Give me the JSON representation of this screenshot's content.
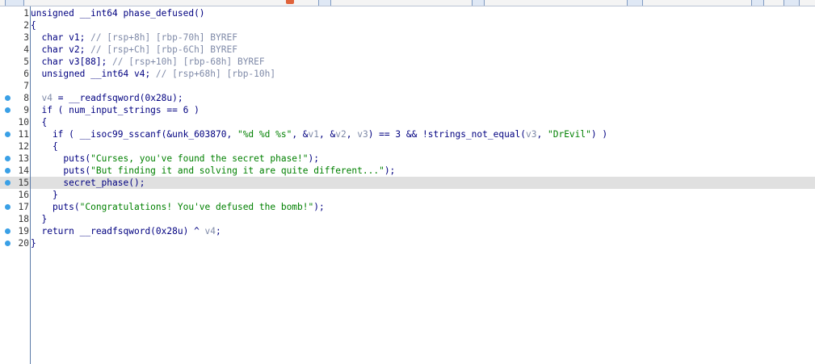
{
  "tabs": [
    {
      "label": ""
    },
    {
      "label": ""
    },
    {
      "label": ""
    },
    {
      "label": ""
    },
    {
      "label": ""
    },
    {
      "label": ""
    }
  ],
  "breakpoint_color": "#3aa0e6",
  "highlighted_line": 15,
  "lines": [
    {
      "n": "1",
      "bp": false,
      "segs": [
        {
          "t": "unsigned __int64 phase_defused()",
          "c": "fn"
        }
      ]
    },
    {
      "n": "2",
      "bp": false,
      "segs": [
        {
          "t": "{",
          "c": "fn"
        }
      ]
    },
    {
      "n": "3",
      "bp": false,
      "segs": [
        {
          "t": "  char v1; ",
          "c": "fn"
        },
        {
          "t": "// [rsp+8h] [rbp-70h] BYREF",
          "c": "cm"
        }
      ]
    },
    {
      "n": "4",
      "bp": false,
      "segs": [
        {
          "t": "  char v2; ",
          "c": "fn"
        },
        {
          "t": "// [rsp+Ch] [rbp-6Ch] BYREF",
          "c": "cm"
        }
      ]
    },
    {
      "n": "5",
      "bp": false,
      "segs": [
        {
          "t": "  char v3[88]; ",
          "c": "fn"
        },
        {
          "t": "// [rsp+10h] [rbp-68h] BYREF",
          "c": "cm"
        }
      ]
    },
    {
      "n": "6",
      "bp": false,
      "segs": [
        {
          "t": "  unsigned __int64 v4; ",
          "c": "fn"
        },
        {
          "t": "// [rsp+68h] [rbp-10h]",
          "c": "cm"
        }
      ]
    },
    {
      "n": "7",
      "bp": false,
      "segs": [
        {
          "t": "",
          "c": "fn"
        }
      ]
    },
    {
      "n": "8",
      "bp": true,
      "segs": [
        {
          "t": "  ",
          "c": "fn"
        },
        {
          "t": "v4",
          "c": "var"
        },
        {
          "t": " = __readfsqword(0x28u);",
          "c": "fn"
        }
      ]
    },
    {
      "n": "9",
      "bp": true,
      "segs": [
        {
          "t": "  if ( num_input_strings == 6 )",
          "c": "fn"
        }
      ]
    },
    {
      "n": "10",
      "bp": false,
      "segs": [
        {
          "t": "  {",
          "c": "fn"
        }
      ]
    },
    {
      "n": "11",
      "bp": true,
      "segs": [
        {
          "t": "    if ( __isoc99_sscanf(&unk_603870, ",
          "c": "fn"
        },
        {
          "t": "\"%d %d %s\"",
          "c": "str"
        },
        {
          "t": ", &",
          "c": "fn"
        },
        {
          "t": "v1",
          "c": "var"
        },
        {
          "t": ", &",
          "c": "fn"
        },
        {
          "t": "v2",
          "c": "var"
        },
        {
          "t": ", ",
          "c": "fn"
        },
        {
          "t": "v3",
          "c": "var"
        },
        {
          "t": ") == 3 && !strings_not_equal(",
          "c": "fn"
        },
        {
          "t": "v3",
          "c": "var"
        },
        {
          "t": ", ",
          "c": "fn"
        },
        {
          "t": "\"DrEvil\"",
          "c": "str"
        },
        {
          "t": ") )",
          "c": "fn"
        }
      ]
    },
    {
      "n": "12",
      "bp": false,
      "segs": [
        {
          "t": "    {",
          "c": "fn"
        }
      ]
    },
    {
      "n": "13",
      "bp": true,
      "segs": [
        {
          "t": "      puts(",
          "c": "fn"
        },
        {
          "t": "\"Curses, you've found the secret phase!\"",
          "c": "str"
        },
        {
          "t": ");",
          "c": "fn"
        }
      ]
    },
    {
      "n": "14",
      "bp": true,
      "segs": [
        {
          "t": "      puts(",
          "c": "fn"
        },
        {
          "t": "\"But finding it and solving it are quite different...\"",
          "c": "str"
        },
        {
          "t": ");",
          "c": "fn"
        }
      ]
    },
    {
      "n": "15",
      "bp": true,
      "segs": [
        {
          "t": "      secret_phase();",
          "c": "fn"
        }
      ]
    },
    {
      "n": "16",
      "bp": false,
      "segs": [
        {
          "t": "    }",
          "c": "fn"
        }
      ]
    },
    {
      "n": "17",
      "bp": true,
      "segs": [
        {
          "t": "    puts(",
          "c": "fn"
        },
        {
          "t": "\"Congratulations! You've defused the bomb!\"",
          "c": "str"
        },
        {
          "t": ");",
          "c": "fn"
        }
      ]
    },
    {
      "n": "18",
      "bp": false,
      "segs": [
        {
          "t": "  }",
          "c": "fn"
        }
      ]
    },
    {
      "n": "19",
      "bp": true,
      "segs": [
        {
          "t": "  return __readfsqword(0x28u) ^ ",
          "c": "fn"
        },
        {
          "t": "v4",
          "c": "var"
        },
        {
          "t": ";",
          "c": "fn"
        }
      ]
    },
    {
      "n": "20",
      "bp": true,
      "segs": [
        {
          "t": "}",
          "c": "fn"
        }
      ]
    }
  ]
}
